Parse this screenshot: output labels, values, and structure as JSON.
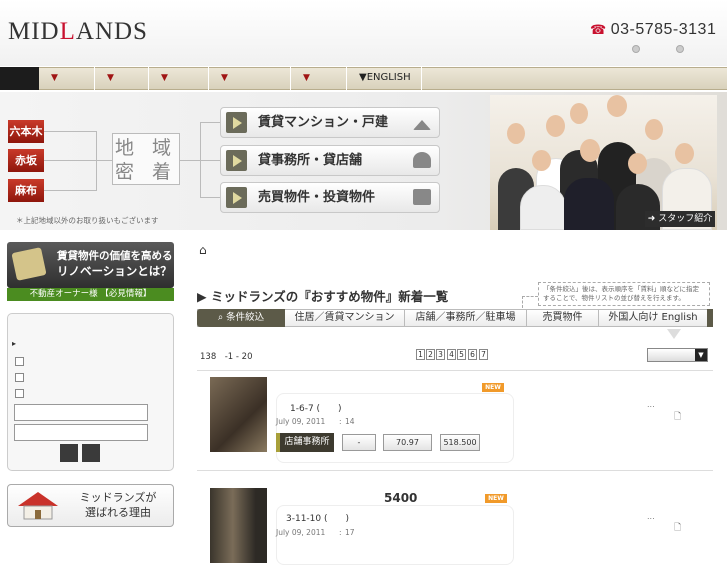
{
  "header": {
    "logo": {
      "pre": "MID",
      "accent": "L",
      "post": "ANDS"
    },
    "phone_icon": "phone-icon",
    "phone": "03-5785-3131"
  },
  "nav": {
    "items": [
      "▼",
      "▼",
      "▼",
      "▼",
      "▼"
    ],
    "english": "▼ENGLISH"
  },
  "hero": {
    "areas": [
      "六本木",
      "赤坂",
      "麻布"
    ],
    "area_box": [
      "地 域",
      "密 着"
    ],
    "categories": [
      "賃貸マンション・戸建",
      "貸事務所・貸店舗",
      "売買物件・投資物件"
    ],
    "note": "＊上記地域以外のお取り扱いもございます",
    "staff": "スタッフ紹介"
  },
  "sidebar": {
    "renovation_line1": "賃貸物件の価値を高める",
    "renovation_line2": "リノベーションとは？",
    "owner": "不動産オーナー様 【必見情報】",
    "search_bullet": "▸",
    "reason_line1": "ミッドランズが",
    "reason_line2": "選ばれる理由"
  },
  "main": {
    "home_icon": "⌂",
    "title": "▶ ミッドランズの『おすすめ物件』新着一覧",
    "hint": "「条件絞込」後は、表示順序を「賃料」順などに指定することで、物件リストの並び替えを行えます。",
    "tabs": [
      "条件絞込",
      "住居／賃貸マンション",
      "店舗／事務所／駐車場",
      "売買物件",
      "外国人向け English"
    ],
    "count": "138　-1 - 20",
    "pages": [
      "1",
      "2",
      "3",
      "4",
      "5",
      "6",
      "7"
    ],
    "listings": [
      {
        "new": "NEW",
        "address": "1-6-7 (　　)",
        "date": "July 09, 2011",
        "sep": ":",
        "num": "14",
        "type": "店舗事務所",
        "v1": "-",
        "v2": "70.97",
        "v3": "518.500",
        "dots": "...",
        "price": ""
      },
      {
        "new": "NEW",
        "address": "3-11-10 (　　)",
        "date": "July 09, 2011",
        "sep": ":",
        "num": "17",
        "type": "",
        "v1": "",
        "v2": "",
        "v3": "",
        "dots": "...",
        "price": "5400"
      }
    ]
  },
  "colors": {
    "brand_red": "#c8102e",
    "nav_bg": "#e3dcc6",
    "dark_tab": "#5c5a48",
    "new_badge": "#f19a2a",
    "owner_green": "#4b8c20"
  }
}
